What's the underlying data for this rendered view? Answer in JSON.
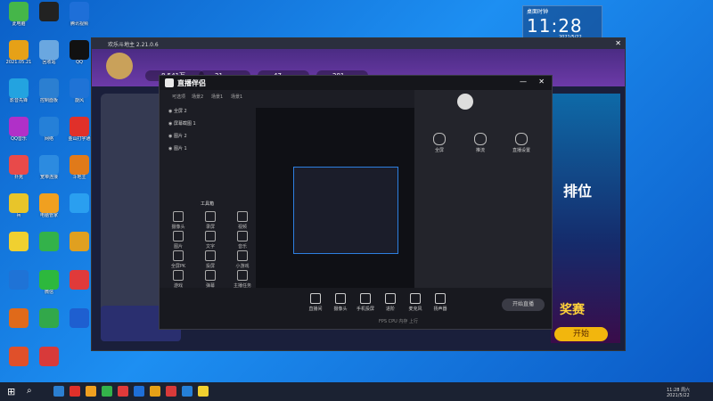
{
  "desktop_icons": [
    {
      "label": "此电脑",
      "color": "#45b649"
    },
    {
      "label": "",
      "color": "#222"
    },
    {
      "label": "腾讯视频",
      "color": "#1e6fd8"
    },
    {
      "label": "2021.05.21",
      "color": "#e6a117"
    },
    {
      "label": "回收站",
      "color": "#6aa7e0"
    },
    {
      "label": "QQ",
      "color": "#111"
    },
    {
      "label": "影音先锋",
      "color": "#23a3e0"
    },
    {
      "label": "控制面板",
      "color": "#2b7fd1"
    },
    {
      "label": "旋风",
      "color": "#1f73d6"
    },
    {
      "label": "QQ音乐",
      "color": "#b030c8"
    },
    {
      "label": "网络",
      "color": "#2580d8"
    },
    {
      "label": "金山打字通",
      "color": "#e0302a"
    },
    {
      "label": "扑克",
      "color": "#e84a4a"
    },
    {
      "label": "宽带连接",
      "color": "#2c8be0"
    },
    {
      "label": "斗地主",
      "color": "#e07a1a"
    },
    {
      "label": "兵",
      "color": "#e8c52a"
    },
    {
      "label": "电脑管家",
      "color": "#f0a020"
    },
    {
      "label": "",
      "color": "#2a9ff0"
    },
    {
      "label": "",
      "color": "#f0d030"
    },
    {
      "label": "",
      "color": "#33b24a"
    },
    {
      "label": "",
      "color": "#e0a020"
    },
    {
      "label": "",
      "color": "#1f73d6"
    },
    {
      "label": "微信",
      "color": "#2db83d"
    },
    {
      "label": "",
      "color": "#e03a3a"
    },
    {
      "label": "",
      "color": "#e06a1a"
    },
    {
      "label": "",
      "color": "#32a84a"
    },
    {
      "label": "",
      "color": "#1e5fd0"
    },
    {
      "label": "",
      "color": "#e0502a"
    },
    {
      "label": "",
      "color": "#d83a3a"
    }
  ],
  "clock": {
    "title": "桌面时钟",
    "time": "11:28",
    "date": "2021/5/22"
  },
  "game": {
    "title": "欢乐斗地主 2.21.0.6",
    "coins": "8.541万",
    "gems": "21",
    "hearts": "47",
    "points": "201",
    "rank_text": "排位",
    "prize_text": "奖赛",
    "start_button": "开始"
  },
  "studio": {
    "title": "直播伴侣",
    "tabs": [
      "可选项",
      "场景2",
      "场景1",
      "场景1"
    ],
    "scenes": [
      "全屏 2",
      "屏幕截图 1",
      "图片 2",
      "图片 1"
    ],
    "tools_label": "工具箱",
    "tools": [
      "摄像头",
      "录屏",
      "视频",
      "图片",
      "文字",
      "音乐",
      "全屏PK",
      "投屏",
      "小游戏",
      "游戏",
      "弹幕",
      "主播任务"
    ],
    "stats": "FPS  CPU  内存  上行",
    "bottom_buttons": [
      "直播间",
      "摄像头",
      "手机投屏",
      "进阶",
      "麦克风",
      "扬声器"
    ],
    "start_live": "开始直播",
    "right_items": [
      "全屏",
      "推流",
      "直播设置"
    ]
  },
  "taskbar": {
    "time": "11:28 周六",
    "date": "2021/5/22"
  }
}
